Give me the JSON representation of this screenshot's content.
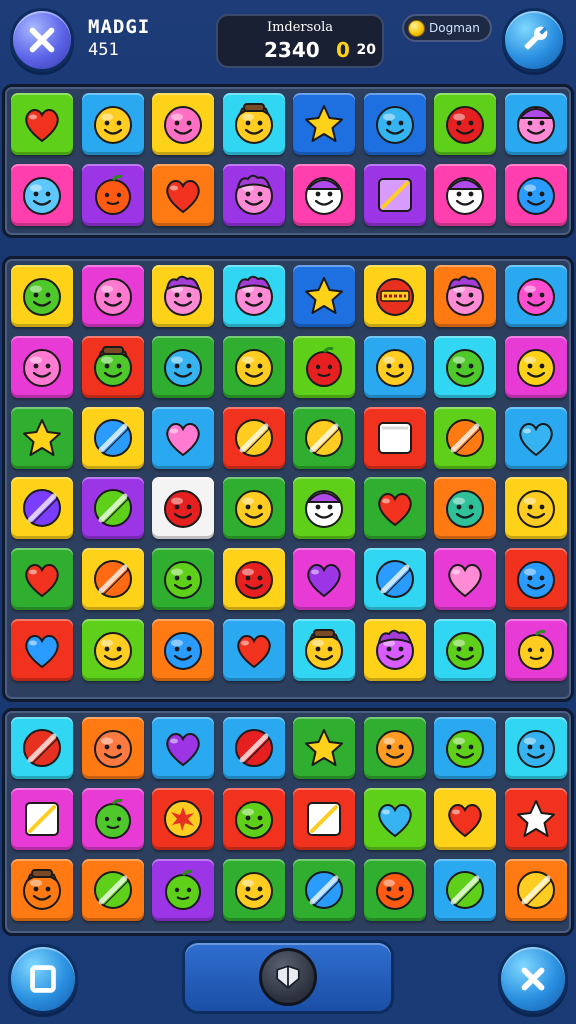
{
  "header": {
    "close_icon": "x-icon",
    "level_name": "MADGI",
    "level_number": "451",
    "score_title": "Imdersola",
    "score_value": "2340",
    "score_accent": "0",
    "moves": "20",
    "coins_label": "Dogman",
    "tools_icon": "wrench-icon"
  },
  "footer": {
    "left_icon": "square-frame-icon",
    "center_icon": "shield-icon",
    "right_icon": "x-icon"
  },
  "colors": {
    "lime": "#5ed01a",
    "sky": "#2aa8f0",
    "yellow": "#ffd21a",
    "cyan": "#31d6f2",
    "blue": "#1e6fe0",
    "green": "#2fae2f",
    "red": "#f0321e",
    "orange": "#ff7a12",
    "pink": "#ff3fae",
    "purple": "#9b35e6",
    "magenta": "#e83ad4",
    "white": "#f4f4f4"
  },
  "boards": [
    {
      "rows": [
        [
          {
            "bg": "lime",
            "icon": "heart",
            "color": "#f0321e"
          },
          {
            "bg": "sky",
            "icon": "smiley",
            "color": "#ffcc22"
          },
          {
            "bg": "yellow",
            "icon": "smiley",
            "color": "#ff6fc2"
          },
          {
            "bg": "cyan",
            "icon": "smiley-hat",
            "color": "#ffcc22"
          },
          {
            "bg": "blue",
            "icon": "star",
            "color": "#ffd21a"
          },
          {
            "bg": "blue",
            "icon": "smiley",
            "color": "#36b4f2"
          },
          {
            "bg": "lime",
            "icon": "smiley",
            "color": "#e62020"
          },
          {
            "bg": "sky",
            "icon": "smiley-cap",
            "color": "#ff8ad6"
          }
        ],
        [
          {
            "bg": "pink",
            "icon": "smiley",
            "color": "#5cc8ff"
          },
          {
            "bg": "purple",
            "icon": "fruit",
            "color": "#ff5a14"
          },
          {
            "bg": "orange",
            "icon": "heart",
            "color": "#f0321e"
          },
          {
            "bg": "purple",
            "icon": "smiley-hair",
            "color": "#ff8ad6"
          },
          {
            "bg": "pink",
            "icon": "smiley-cap",
            "color": "#ffffff"
          },
          {
            "bg": "purple",
            "icon": "slash-block",
            "color": "#d89cff"
          },
          {
            "bg": "pink",
            "icon": "smiley-cap",
            "color": "#ffffff"
          },
          {
            "bg": "pink",
            "icon": "smiley",
            "color": "#2a9cff"
          }
        ]
      ]
    },
    {
      "rows": [
        [
          {
            "bg": "yellow",
            "icon": "smiley",
            "color": "#4ec82a"
          },
          {
            "bg": "magenta",
            "icon": "smiley",
            "color": "#ff7ad0"
          },
          {
            "bg": "yellow",
            "icon": "smiley-hair",
            "color": "#ff8ad6"
          },
          {
            "bg": "cyan",
            "icon": "smiley-hair",
            "color": "#ff8ad6"
          },
          {
            "bg": "blue",
            "icon": "star",
            "color": "#ffd21a"
          },
          {
            "bg": "yellow",
            "icon": "smiley-box",
            "color": "#e83020"
          },
          {
            "bg": "orange",
            "icon": "smiley-hair",
            "color": "#ff8ad6"
          },
          {
            "bg": "sky",
            "icon": "smiley",
            "color": "#ff4fd0"
          }
        ],
        [
          {
            "bg": "magenta",
            "icon": "smiley",
            "color": "#ff7ad0"
          },
          {
            "bg": "red",
            "icon": "smiley-hat",
            "color": "#4ec82a"
          },
          {
            "bg": "green",
            "icon": "smiley",
            "color": "#36b4f2"
          },
          {
            "bg": "green",
            "icon": "smiley",
            "color": "#ffcc22"
          },
          {
            "bg": "lime",
            "icon": "fruit",
            "color": "#e62020"
          },
          {
            "bg": "sky",
            "icon": "smiley",
            "color": "#ffcc22"
          },
          {
            "bg": "cyan",
            "icon": "smiley",
            "color": "#4ec82a"
          },
          {
            "bg": "magenta",
            "icon": "smiley",
            "color": "#ffd21a"
          }
        ],
        [
          {
            "bg": "green",
            "icon": "star",
            "color": "#ffd21a"
          },
          {
            "bg": "yellow",
            "icon": "slash-ball",
            "color": "#2a9cff"
          },
          {
            "bg": "sky",
            "icon": "heart",
            "color": "#ff7ad0"
          },
          {
            "bg": "red",
            "icon": "slash-ball",
            "color": "#ffcc22"
          },
          {
            "bg": "green",
            "icon": "slash-ball",
            "color": "#ffcc22"
          },
          {
            "bg": "red",
            "icon": "square",
            "color": "#ffffff"
          },
          {
            "bg": "lime",
            "icon": "slash-ball",
            "color": "#ff7a12"
          },
          {
            "bg": "sky",
            "icon": "heart",
            "color": "#36b4f2"
          }
        ],
        [
          {
            "bg": "yellow",
            "icon": "slash-ball",
            "color": "#7a3cff"
          },
          {
            "bg": "purple",
            "icon": "slash-ball",
            "color": "#5ed01a"
          },
          {
            "bg": "white",
            "icon": "smiley",
            "color": "#e62020"
          },
          {
            "bg": "green",
            "icon": "smiley",
            "color": "#ffcc22"
          },
          {
            "bg": "lime",
            "icon": "smiley-cap",
            "color": "#ffffff"
          },
          {
            "bg": "green",
            "icon": "heart",
            "color": "#f0321e"
          },
          {
            "bg": "orange",
            "icon": "smiley",
            "color": "#2fc29a"
          },
          {
            "bg": "yellow",
            "icon": "smiley",
            "color": "#ffcc22"
          }
        ],
        [
          {
            "bg": "green",
            "icon": "heart",
            "color": "#f0321e"
          },
          {
            "bg": "yellow",
            "icon": "slash-ball",
            "color": "#ff6a12"
          },
          {
            "bg": "green",
            "icon": "smiley",
            "color": "#5ed01a"
          },
          {
            "bg": "yellow",
            "icon": "smiley",
            "color": "#e62020"
          },
          {
            "bg": "magenta",
            "icon": "heart",
            "color": "#9b35e6"
          },
          {
            "bg": "cyan",
            "icon": "slash-ball",
            "color": "#2a9cff"
          },
          {
            "bg": "magenta",
            "icon": "heart",
            "color": "#ff8ad6"
          },
          {
            "bg": "red",
            "icon": "smiley",
            "color": "#2a9cff"
          }
        ],
        [
          {
            "bg": "red",
            "icon": "heart",
            "color": "#2a9cff"
          },
          {
            "bg": "lime",
            "icon": "smiley",
            "color": "#ffcc22"
          },
          {
            "bg": "orange",
            "icon": "smiley",
            "color": "#2a9cff"
          },
          {
            "bg": "sky",
            "icon": "heart",
            "color": "#f0321e"
          },
          {
            "bg": "cyan",
            "icon": "smiley-hat",
            "color": "#ffcc22"
          },
          {
            "bg": "yellow",
            "icon": "smiley-hair",
            "color": "#d85cff"
          },
          {
            "bg": "cyan",
            "icon": "smiley",
            "color": "#5ed01a"
          },
          {
            "bg": "magenta",
            "icon": "fruit",
            "color": "#ffcc22"
          }
        ]
      ]
    },
    {
      "rows": [
        [
          {
            "bg": "cyan",
            "icon": "slash-ball",
            "color": "#e83020"
          },
          {
            "bg": "orange",
            "icon": "smiley",
            "color": "#ff7a40"
          },
          {
            "bg": "sky",
            "icon": "heart",
            "color": "#9b35e6"
          },
          {
            "bg": "sky",
            "icon": "slash-ball",
            "color": "#e62020"
          },
          {
            "bg": "green",
            "icon": "star",
            "color": "#ffd21a"
          },
          {
            "bg": "green",
            "icon": "smiley",
            "color": "#ff9a22"
          },
          {
            "bg": "sky",
            "icon": "smiley",
            "color": "#5ed01a"
          },
          {
            "bg": "cyan",
            "icon": "smiley",
            "color": "#36b4f2"
          }
        ],
        [
          {
            "bg": "magenta",
            "icon": "slash-block",
            "color": "#ffffff"
          },
          {
            "bg": "magenta",
            "icon": "fruit",
            "color": "#4ec82a"
          },
          {
            "bg": "red",
            "icon": "splat",
            "color": "#ffcc22"
          },
          {
            "bg": "red",
            "icon": "smiley",
            "color": "#5ed01a"
          },
          {
            "bg": "red",
            "icon": "slash-block",
            "color": "#ffffff"
          },
          {
            "bg": "lime",
            "icon": "heart",
            "color": "#36b4f2"
          },
          {
            "bg": "yellow",
            "icon": "heart",
            "color": "#f0321e"
          },
          {
            "bg": "red",
            "icon": "star",
            "color": "#ffffff"
          }
        ],
        [
          {
            "bg": "orange",
            "icon": "smiley-hat",
            "color": "#ff7a12"
          },
          {
            "bg": "orange",
            "icon": "slash-ball",
            "color": "#5ed01a"
          },
          {
            "bg": "purple",
            "icon": "fruit",
            "color": "#5ed01a"
          },
          {
            "bg": "green",
            "icon": "smiley",
            "color": "#ffcc22"
          },
          {
            "bg": "green",
            "icon": "slash-ball",
            "color": "#2a9cff"
          },
          {
            "bg": "green",
            "icon": "smiley",
            "color": "#ff5a14"
          },
          {
            "bg": "sky",
            "icon": "slash-ball",
            "color": "#5ed01a"
          },
          {
            "bg": "orange",
            "icon": "slash-ball",
            "color": "#ffcc22"
          }
        ]
      ]
    }
  ]
}
